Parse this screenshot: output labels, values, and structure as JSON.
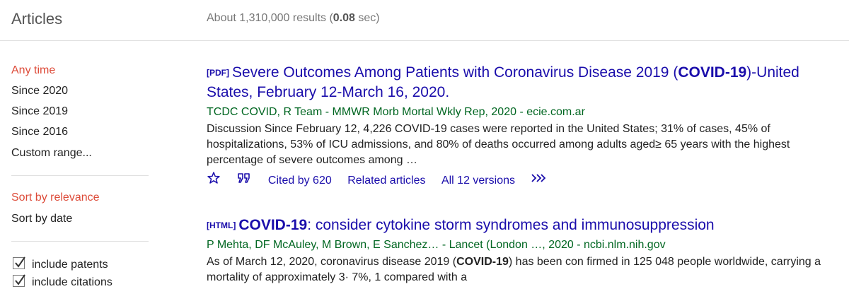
{
  "header": {
    "title": "Articles",
    "stats_prefix": "About 1,310,000 results (",
    "stats_time": "0.08",
    "stats_suffix": " sec)"
  },
  "sidebar": {
    "time_filters": [
      "Any time",
      "Since 2020",
      "Since 2019",
      "Since 2016",
      "Custom range..."
    ],
    "sort_options": [
      "Sort by relevance",
      "Sort by date"
    ],
    "checkboxes": [
      {
        "label": "include patents",
        "checked": true
      },
      {
        "label": "include citations",
        "checked": true
      }
    ]
  },
  "results": [
    {
      "tag": "[PDF]",
      "title_before": "Severe Outcomes Among Patients with Coronavirus Disease 2019 (",
      "title_bold": "COVID-19",
      "title_after": ")-United States, February 12-March 16, 2020.",
      "meta": "TCDC COVID, R Team - MMWR Morb Mortal Wkly Rep, 2020 - ecie.com.ar",
      "snippet": "Discussion Since February 12, 4,226 COVID-19 cases were reported in the United States; 31% of cases, 45% of hospitalizations, 53% of ICU admissions, and 80% of deaths occurred among adults aged≥ 65 years with the highest percentage of severe outcomes among …",
      "cited_by": "Cited by 620",
      "related": "Related articles",
      "versions": "All 12 versions"
    },
    {
      "tag": "[HTML]",
      "title_bold": "COVID-19",
      "title_after": ": consider cytokine storm syndromes and immunosuppression",
      "meta": "P Mehta, DF McAuley, M Brown, E Sanchez… - Lancet (London …, 2020 - ncbi.nlm.nih.gov",
      "snippet_before": "As of March 12, 2020, coronavirus disease 2019 (",
      "snippet_bold": "COVID-19",
      "snippet_after": ") has been con firmed in 125 048 people worldwide, carrying a mortality of approximately 3· 7%, 1 compared with a"
    }
  ],
  "colors": {
    "link": "#1a0dab",
    "meta_green": "#006621",
    "active_red": "#dd4b39"
  },
  "icons": [
    "star-icon",
    "quote-icon",
    "more-icon",
    "checkbox-checked-icon"
  ]
}
